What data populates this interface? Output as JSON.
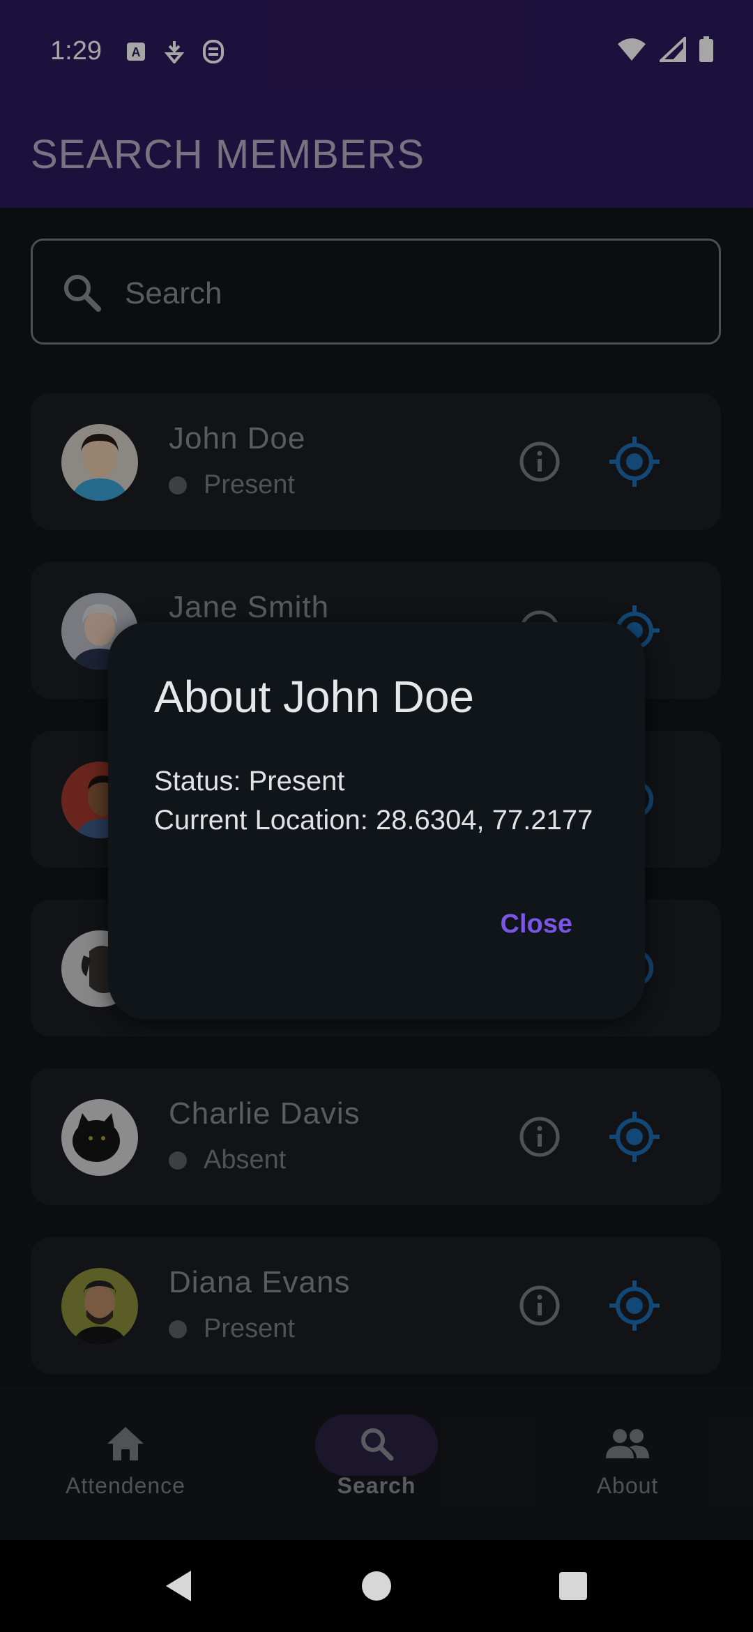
{
  "status_bar": {
    "time": "1:29",
    "left_icons": [
      "keyboard-a-icon",
      "download-badge-icon",
      "shield-notification-icon"
    ],
    "right_icons": [
      "wifi-icon",
      "signal-icon",
      "battery-icon"
    ]
  },
  "app_bar": {
    "title": "SEARCH MEMBERS",
    "background": "#2c1a5c"
  },
  "search": {
    "placeholder": "Search",
    "value": ""
  },
  "members": [
    {
      "name": "John Doe",
      "status": "Present",
      "avatar": "woman-portrait"
    },
    {
      "name": "Jane Smith",
      "status": "",
      "avatar": "older-woman-portrait"
    },
    {
      "name": "",
      "status": "",
      "avatar": "man-portrait"
    },
    {
      "name": "",
      "status": "",
      "avatar": "dog-portrait"
    },
    {
      "name": "Charlie Davis",
      "status": "Absent",
      "avatar": "black-cat-portrait"
    },
    {
      "name": "Diana Evans",
      "status": "Present",
      "avatar": "bearded-man-portrait"
    }
  ],
  "dialog": {
    "title": "About John Doe",
    "status_line": "Status: Present",
    "location_line": "Current Location: 28.6304, 77.2177",
    "close_label": "Close"
  },
  "bottom_nav": {
    "items": [
      {
        "label": "Attendence",
        "icon": "home-icon",
        "active": false
      },
      {
        "label": "Search",
        "icon": "search-icon",
        "active": true
      },
      {
        "label": "About",
        "icon": "people-icon",
        "active": false
      }
    ]
  },
  "colors": {
    "accent": "#7b55e6",
    "locate_icon": "#1e6fb5",
    "background": "#111418"
  }
}
